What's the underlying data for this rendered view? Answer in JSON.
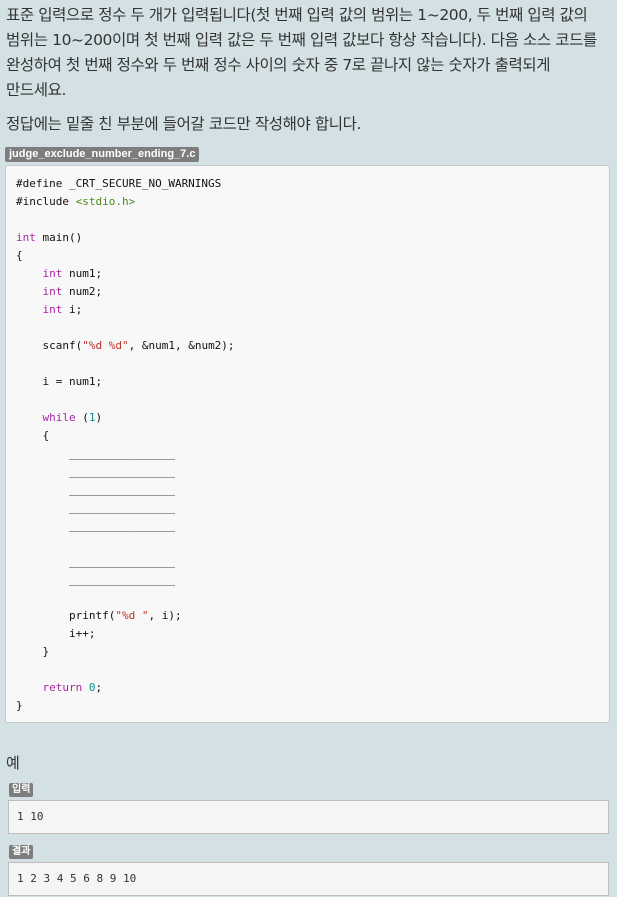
{
  "problem": {
    "description": "표준 입력으로 정수 두 개가 입력됩니다(첫 번째 입력 값의 범위는 1~200, 두 번째 입력 값의 범위는 10~200이며 첫 번째 입력 값은 두 번째 입력 값보다 항상 작습니다). 다음 소스 코드를 완성하여 첫 번째 정수와 두 번째 정수 사이의 숫자 중 7로 끝나지 않는 숫자가 출력되게 만드세요.",
    "note": "정답에는 밑줄 친 부분에 들어갈 코드만 작성해야 합니다."
  },
  "source_file": {
    "filename": "judge_exclude_number_ending_7.c",
    "code_lines": [
      "#define _CRT_SECURE_NO_WARNINGS",
      "#include <stdio.h>",
      "",
      "int main()",
      "{",
      "    int num1;",
      "    int num2;",
      "    int i;",
      "",
      "    scanf(\"%d %d\", &num1, &num2);",
      "",
      "    i = num1;",
      "",
      "    while (1)",
      "    {",
      "        ________________",
      "        ________________",
      "        ________________",
      "        ________________",
      "        ________________",
      "",
      "        ________________",
      "        ________________",
      "",
      "        printf(\"%d \", i);",
      "        i++;",
      "    }",
      "",
      "    return 0;",
      "}"
    ]
  },
  "example": {
    "title": "예",
    "input_label": "입력",
    "input_value": "1 10",
    "output_label": "결과",
    "output_value": "1 2 3 4 5 6 8 9 10"
  },
  "colors": {
    "page_background": "#d3e1e5",
    "label_background": "#7d7d7d",
    "code_background": "#f8f8f8",
    "keyword": "#a626a4",
    "string": "#b8322c",
    "include": "#4b8a1d",
    "number": "#0f8a8a"
  }
}
